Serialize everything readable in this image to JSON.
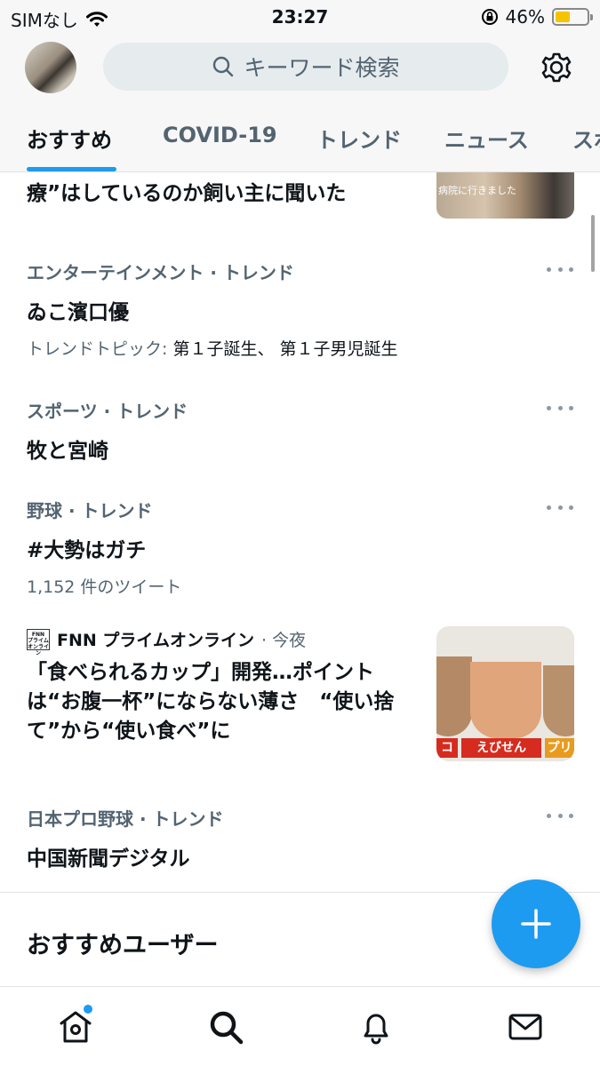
{
  "status_bar": {
    "carrier": "SIMなし",
    "time": "23:27",
    "battery": "46%",
    "battery_level": 0.46
  },
  "header": {
    "search_placeholder": "キーワード検索"
  },
  "tabs": [
    {
      "label": "おすすめ",
      "active": true
    },
    {
      "label": "COVID-19"
    },
    {
      "label": "トレンド"
    },
    {
      "label": "ニュース"
    },
    {
      "label": "スポ"
    }
  ],
  "top_news": {
    "title_fragment": "療”はしているのか飼い主に聞いた",
    "thumb_caption": "病院に行きました"
  },
  "trends": [
    {
      "meta": "エンターテインメント · トレンド",
      "name": "ゐこ濱口優",
      "sub_label": "トレンドトピック: ",
      "sub_value": "第１子誕生、 第１子男児誕生"
    },
    {
      "meta": "スポーツ · トレンド",
      "name": "牧と宮崎"
    },
    {
      "meta": "野球 · トレンド",
      "name": "#大勢はガチ",
      "sub_label": "1,152 件のツイート"
    },
    {
      "meta": "日本プロ野球 · トレンド",
      "name": "中国新聞デジタル"
    }
  ],
  "news": {
    "source_logo": "FNN プライム オンライン",
    "source": "FNN プライムオンライン",
    "time": " · 今夜",
    "headline": "「食べられるカップ」開発…ポイントは“お腹一杯”にならない薄さ　“使い捨て”から“使い食べ”に",
    "thumb_banners": [
      "コ",
      "えびせん",
      "プリ"
    ]
  },
  "section": {
    "title": "おすすめユーザー"
  },
  "colors": {
    "accent": "#1d9bf0",
    "secondary_text": "#536471",
    "primary_text": "#0f1419"
  }
}
